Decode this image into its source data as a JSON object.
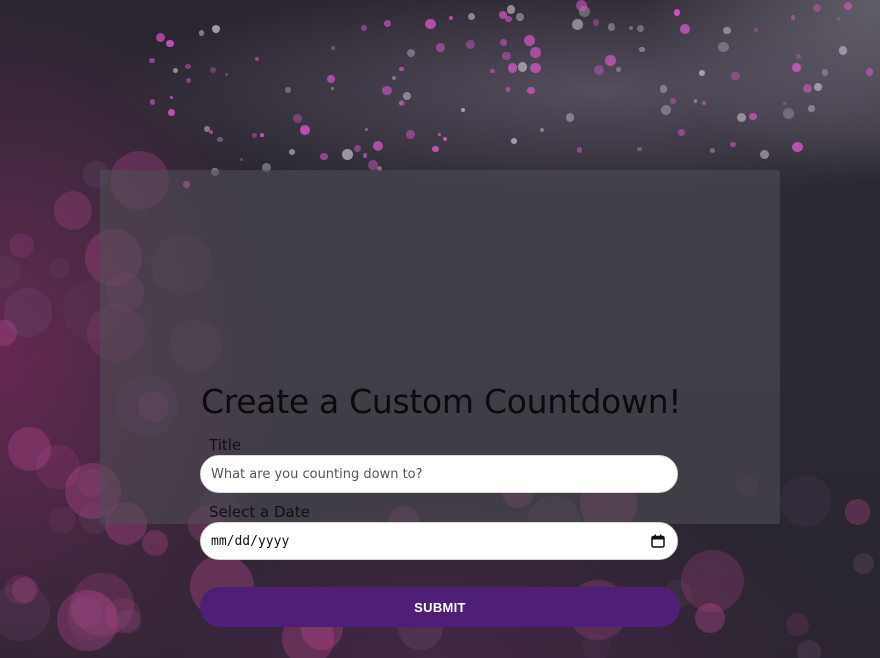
{
  "form": {
    "heading": "Create a Custom Countdown!",
    "title_label": "Title",
    "title_placeholder": "What are you counting down to?",
    "title_value": "",
    "date_label": "Select a Date",
    "date_display": "mm/dd/yyyy",
    "date_icon": "calendar-icon",
    "submit_label": "SUBMIT"
  },
  "colors": {
    "submit_button": "#4f1f77",
    "panel": "rgba(80,78,84,0.58)",
    "bokeh_pink": "#e05ad0",
    "background": "#2a2530"
  }
}
